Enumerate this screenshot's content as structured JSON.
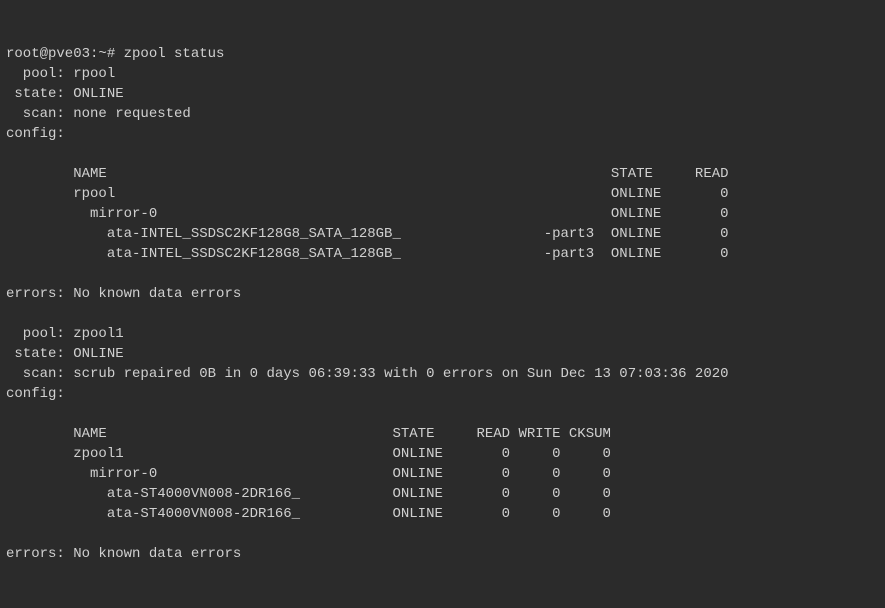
{
  "prompt": "root@pve03:~# ",
  "command": "zpool status",
  "pool1": {
    "pool_label": "  pool: ",
    "pool_name": "rpool",
    "state_label": " state: ",
    "state_value": "ONLINE",
    "scan_label": "  scan: ",
    "scan_value": "none requested",
    "config_label": "config:",
    "headers": "        NAME                                                            STATE     READ ",
    "row0": "        rpool                                                           ONLINE       0",
    "row1": "          mirror-0                                                      ONLINE       0",
    "row2": "            ata-INTEL_SSDSC2KF128G8_SATA_128GB_                 -part3  ONLINE       0",
    "row3": "            ata-INTEL_SSDSC2KF128G8_SATA_128GB_                 -part3  ONLINE       0",
    "errors_label": "errors: ",
    "errors_value": "No known data errors"
  },
  "pool2": {
    "pool_label": "  pool: ",
    "pool_name": "zpool1",
    "state_label": " state: ",
    "state_value": "ONLINE",
    "scan_label": "  scan: ",
    "scan_value": "scrub repaired 0B in 0 days 06:39:33 with 0 errors on Sun Dec 13 07:03:36 2020",
    "config_label": "config:",
    "headers": "        NAME                                  STATE     READ WRITE CKSUM",
    "row0": "        zpool1                                ONLINE       0     0     0",
    "row1": "          mirror-0                            ONLINE       0     0     0",
    "row2": "            ata-ST4000VN008-2DR166_           ONLINE       0     0     0",
    "row3": "            ata-ST4000VN008-2DR166_           ONLINE       0     0     0",
    "errors_label": "errors: ",
    "errors_value": "No known data errors"
  }
}
